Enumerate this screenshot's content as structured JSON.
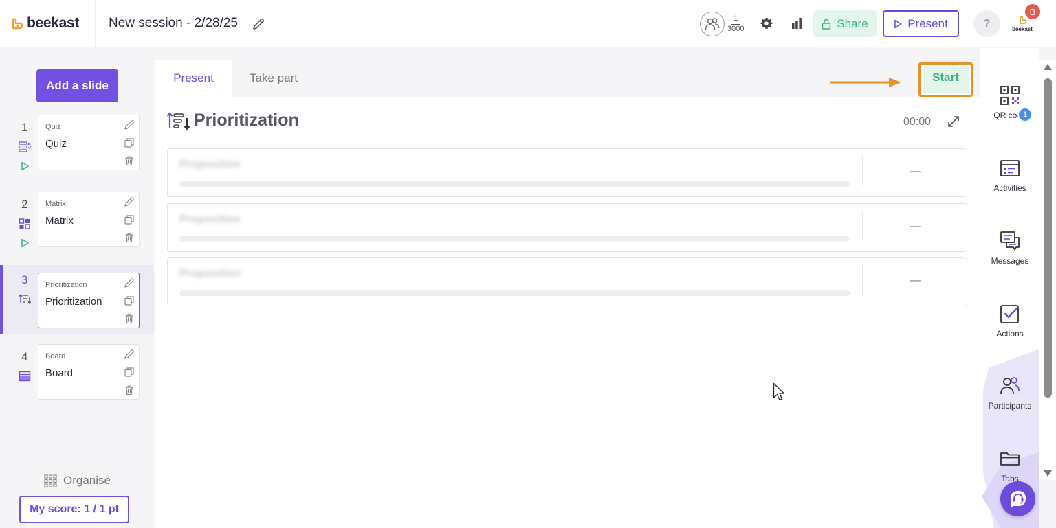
{
  "header": {
    "brand": "beekast",
    "session_title": "New session - 2/28/25",
    "participants_current": "1",
    "participants_max": "3000",
    "share_label": "Share",
    "present_label": "Present",
    "help_label": "?",
    "user_initial": "B",
    "user_logo_text": "beekast"
  },
  "sidebar": {
    "add_slide_label": "Add a slide",
    "slides": [
      {
        "number": "1",
        "kind": "Quiz",
        "name": "Quiz"
      },
      {
        "number": "2",
        "kind": "Matrix",
        "name": "Matrix"
      },
      {
        "number": "3",
        "kind": "Prioritization",
        "name": "Prioritization"
      },
      {
        "number": "4",
        "kind": "Board",
        "name": "Board"
      }
    ],
    "organise_label": "Organise",
    "score_label": "My score: 1 / 1 pt"
  },
  "main": {
    "tabs": [
      {
        "label": "Present",
        "active": true
      },
      {
        "label": "Take part",
        "active": false
      }
    ],
    "start_label": "Start",
    "question_title": "Prioritization",
    "timer": "00:00",
    "propositions": [
      {
        "label": "Proposition",
        "score": "—"
      },
      {
        "label": "Proposition",
        "score": "—"
      },
      {
        "label": "Proposition",
        "score": "—"
      }
    ]
  },
  "right_panel": {
    "items": [
      {
        "label": "QR code",
        "icon": "qr-code-icon"
      },
      {
        "label": "Activities",
        "icon": "activities-icon",
        "badge": "1"
      },
      {
        "label": "Messages",
        "icon": "messages-icon"
      },
      {
        "label": "Actions",
        "icon": "actions-icon"
      },
      {
        "label": "Participants",
        "icon": "participants-icon"
      },
      {
        "label": "Tabs",
        "icon": "tabs-icon"
      }
    ]
  },
  "colors": {
    "accent": "#7150e2",
    "share_green": "#3ab37a",
    "highlight_orange": "#e8902a",
    "badge_red": "#e85a4f",
    "badge_blue": "#4a90e2"
  }
}
